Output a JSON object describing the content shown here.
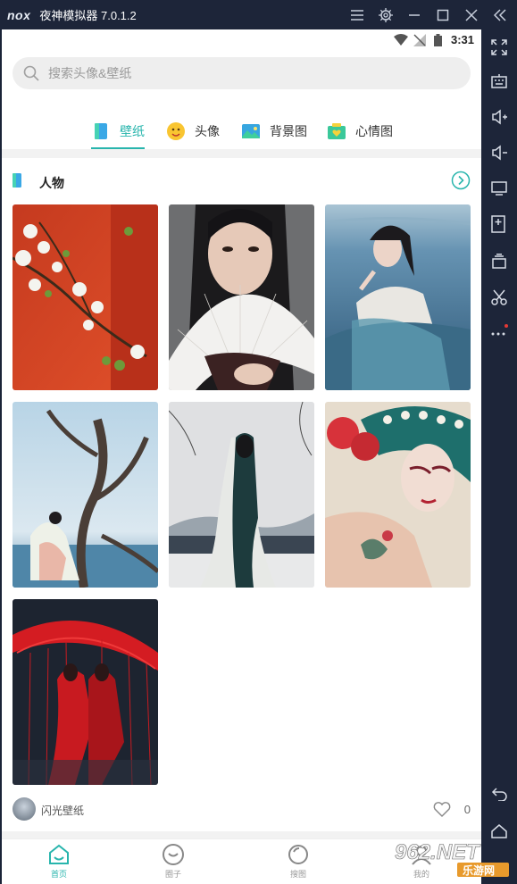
{
  "window": {
    "brand": "nox",
    "title": "夜神模拟器 7.0.1.2",
    "controls": [
      "menu-icon",
      "settings-icon",
      "minimize-icon",
      "maximize-icon",
      "close-icon",
      "collapse-icon"
    ]
  },
  "statusbar": {
    "time": "3:31"
  },
  "search": {
    "placeholder": "搜索头像&壁纸"
  },
  "tabs": [
    {
      "label": "壁纸",
      "icon": "wallpaper-icon",
      "active": true
    },
    {
      "label": "头像",
      "icon": "avatar-icon",
      "active": false
    },
    {
      "label": "背景图",
      "icon": "background-icon",
      "active": false
    },
    {
      "label": "心情图",
      "icon": "mood-icon",
      "active": false
    }
  ],
  "section": {
    "title": "人物",
    "more_icon": "arrow-right-circle-icon"
  },
  "gallery": [
    {
      "name": "red-wall-blossom"
    },
    {
      "name": "fan-portrait"
    },
    {
      "name": "water-hanfu"
    },
    {
      "name": "tree-hanfu"
    },
    {
      "name": "misty-back"
    },
    {
      "name": "opera-makeup"
    },
    {
      "name": "red-umbrella"
    }
  ],
  "footer": {
    "author": "闪光壁纸",
    "likes": "0"
  },
  "bottomnav": [
    {
      "label": "首页",
      "active": true
    },
    {
      "label": "圈子",
      "active": false
    },
    {
      "label": "搜图",
      "active": false
    },
    {
      "label": "我的",
      "active": false
    }
  ],
  "watermark": {
    "text": "962.NET",
    "subtext": "乐游网"
  },
  "colors": {
    "accent": "#28b5ad",
    "chrome": "#1d2539"
  }
}
